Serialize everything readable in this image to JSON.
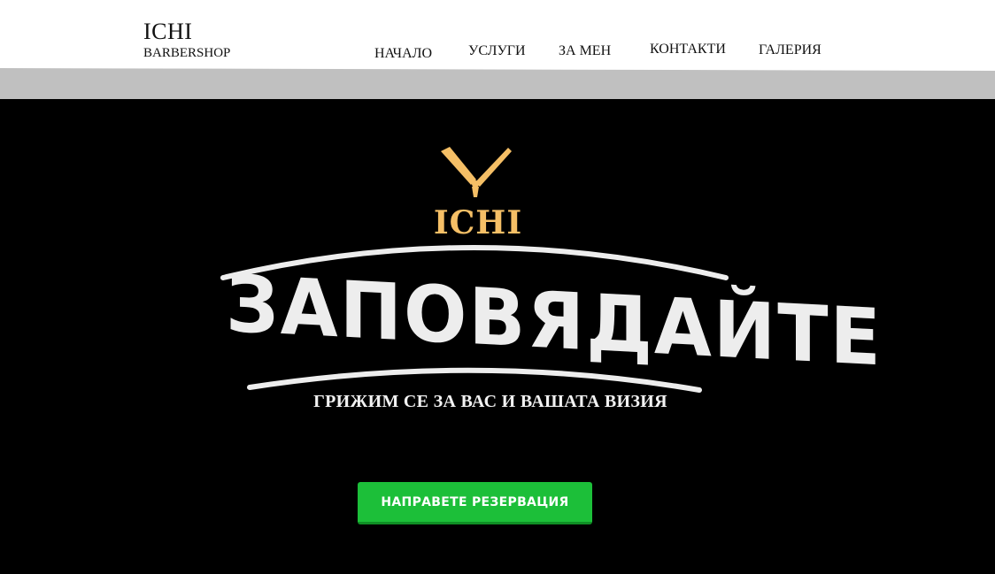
{
  "header": {
    "brand_name": "ICHI",
    "brand_sub": "BARBERSHOP",
    "nav": [
      {
        "label": "НАЧАЛО"
      },
      {
        "label": "УСЛУГИ"
      },
      {
        "label": "ЗА МЕН"
      },
      {
        "label": "КОНТАКТИ"
      },
      {
        "label": "ГАЛЕРИЯ"
      }
    ]
  },
  "hero": {
    "logo_text": "ICHI",
    "welcome": "ЗАПОВЯДАЙТЕ",
    "tagline": "ГРИЖИМ СЕ ЗА ВАС И ВАШАТА ВИЗИЯ",
    "cta_label": "НАПРАВЕТЕ РЕЗЕРВАЦИЯ",
    "icon": "razor-icon"
  },
  "colors": {
    "accent_gold": "#f5bf66",
    "cta_green": "#1cbf39",
    "band_gray": "#c0c0c0",
    "hero_bg": "#000000"
  }
}
